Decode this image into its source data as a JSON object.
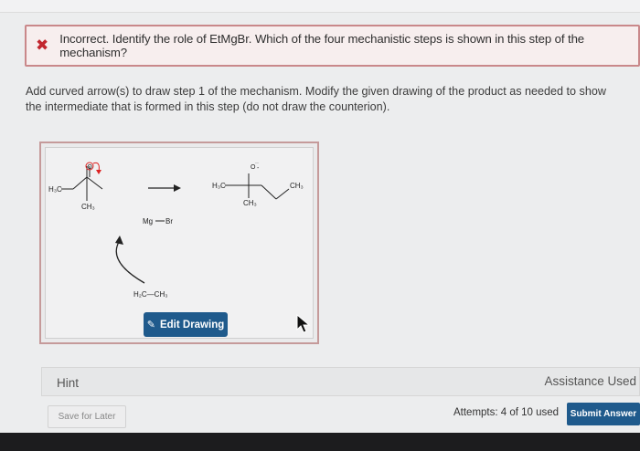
{
  "feedback": {
    "status_icon": "x-icon",
    "status_color": "#c2262e",
    "message": "Incorrect. Identify the role of EtMgBr. Which of the four mechanistic steps is shown in this step of the mechanism?"
  },
  "instructions": "Add curved arrow(s) to draw step 1 of the mechanism. Modify the given drawing of the product as needed to show the intermediate that is formed in this step (do not draw the counterion).",
  "drawing": {
    "reactant_left_group": "H₃C",
    "reactant_bottom_group": "CH₃",
    "reactant_oxygen": "O",
    "reagent_metal": "Mg",
    "reagent_halogen": "Br",
    "reagent_ethyl": "H₂C—CH₃",
    "product_left_group": "H₃C",
    "product_bottom_group": "CH₃",
    "product_right_group": "CH₃",
    "product_oxygen": "O",
    "edit_button_label": "Edit Drawing"
  },
  "hint_label": "Hint",
  "assistance_label": "Assistance Used",
  "save_label": "Save for Later",
  "attempts_text": "Attempts: 4 of 10 used",
  "submit_label": "Submit Answer",
  "colors": {
    "accent": "#1f5a8c",
    "error_border": "#c9888a"
  }
}
